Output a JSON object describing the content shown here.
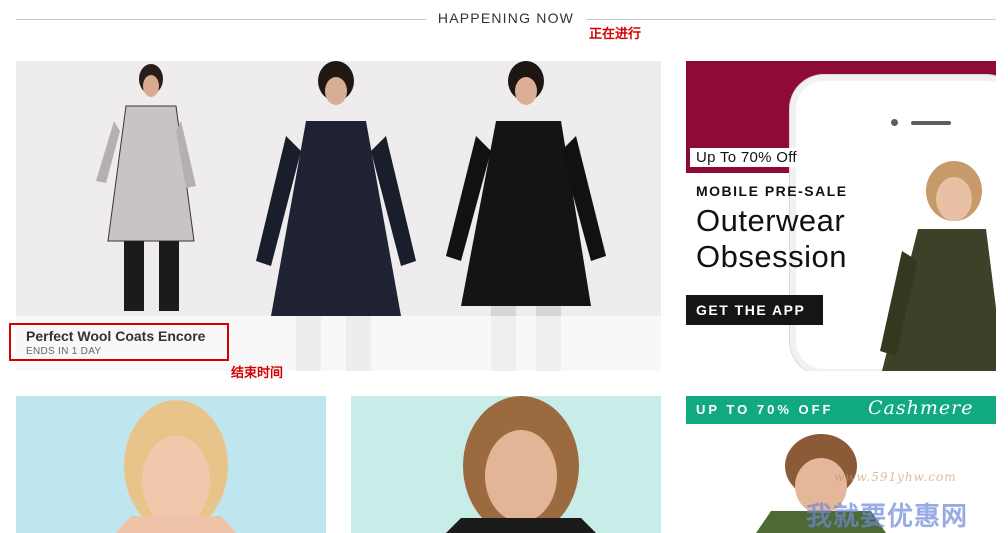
{
  "section": {
    "title": "HAPPENING NOW"
  },
  "annotations": {
    "happening_now": "正在进行",
    "end_time": "结束时间"
  },
  "hero": {
    "title": "Perfect Wool Coats Encore",
    "subtitle": "ENDS IN 1 DAY"
  },
  "promo": {
    "deal": "Up To 70% Off",
    "kicker": "MOBILE PRE-SALE",
    "headline_line1": "Outerwear",
    "headline_line2": "Obsession",
    "cta": "GET THE APP",
    "brand_color": "#8e0b35"
  },
  "tiles": [
    {
      "name": "tile-1",
      "bg": "#bfe6ef"
    },
    {
      "name": "tile-2",
      "bg": "#c8ece8"
    },
    {
      "name": "tile-3",
      "band_text": "UP TO 70% OFF",
      "band_script": "Cashmere",
      "band_color": "#11aa80"
    }
  ],
  "watermark": {
    "text": "我就要优惠网",
    "url": "www.591yhw.com"
  }
}
